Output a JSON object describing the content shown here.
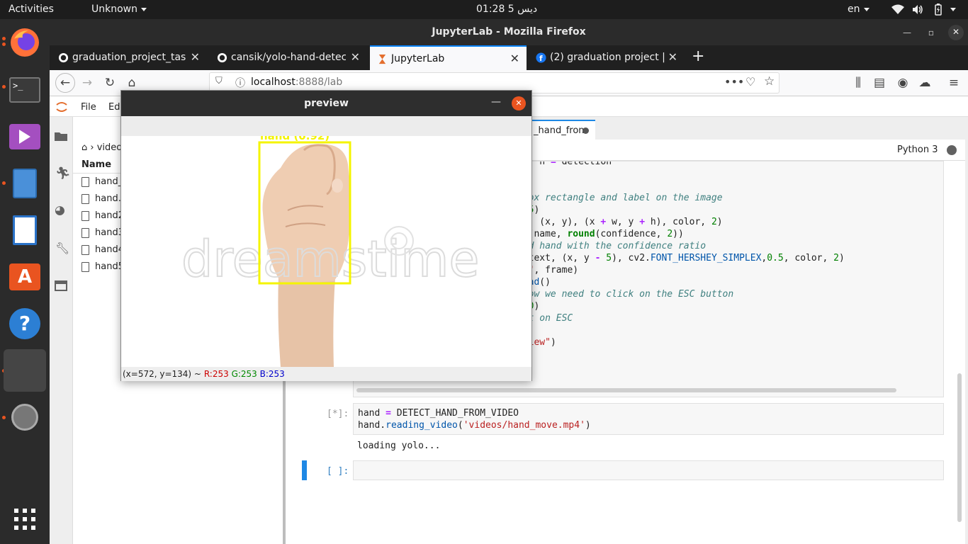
{
  "topbar": {
    "activities": "Activities",
    "app_menu": "Unknown",
    "clock": "01:28  دیس 5",
    "language": "en"
  },
  "dock": {
    "items": [
      "firefox",
      "terminal",
      "media-player",
      "files",
      "writer",
      "software",
      "help",
      "app-grid-placeholder",
      "disc",
      "show-apps"
    ]
  },
  "window": {
    "title": "JupyterLab - Mozilla Firefox"
  },
  "tabs": [
    {
      "label": "graduation_project_task",
      "icon": "github-icon"
    },
    {
      "label": "cansik/yolo-hand-detecti",
      "icon": "github-icon"
    },
    {
      "label": "JupyterLab",
      "icon": "jupyter-icon",
      "active": true
    },
    {
      "label": "(2) graduation project | F",
      "icon": "facebook-icon"
    }
  ],
  "urlbar": {
    "host": "localhost",
    "rest": ":8888/lab"
  },
  "jlab": {
    "menu": [
      "File",
      "Ed"
    ],
    "breadcrumb": "video",
    "filelist_header": "Name",
    "files": [
      "hand_",
      "hand.",
      "hand2",
      "hand3",
      "hand4",
      "hand5"
    ],
    "notebook_tab": "_hand_from",
    "kernel": "Python 3",
    "cell2_prompt": "[*]:",
    "cell2_output": "loading yolo...",
    "cell3_prompt": "[ ]:"
  },
  "preview": {
    "title": "preview",
    "detection_label": "hand (0.92)",
    "watermark": "dreamstime",
    "status_pos": "(x=572, y=134) ~",
    "status_r": "R:253",
    "status_g": "G:253",
    "status_b": "B:253"
  },
  "colors": {
    "accent": "#0a84ff",
    "ubuntu_orange": "#e95420",
    "detection_box": "#f4f400",
    "jupyter_blue": "#1e88e5"
  }
}
